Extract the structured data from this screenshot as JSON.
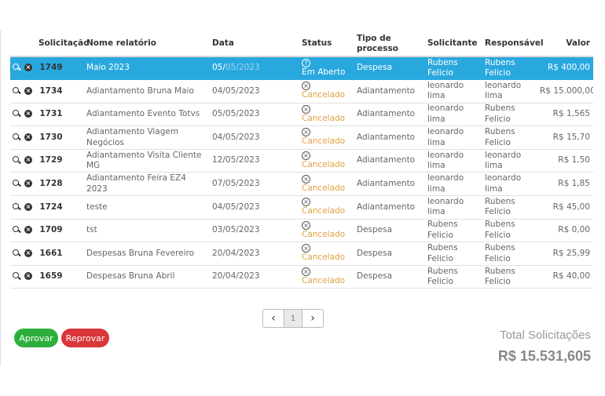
{
  "table": {
    "headers": {
      "solicitacao": "Solicitação",
      "nome": "Nome relatório",
      "data": "Data",
      "status": "Status",
      "tipo": "Tipo de processo",
      "solicitante": "Solicitante",
      "responsavel": "Responsável",
      "valor": "Valor"
    },
    "rows": [
      {
        "id": "1749",
        "nome": "Maio 2023",
        "data": "05/05/2023",
        "status": "Em Aberto",
        "tipo": "Despesa",
        "solicitante": "Rubens Felicio",
        "responsavel": "Rubens Felicio",
        "valor": "R$ 400,00",
        "selected": true
      },
      {
        "id": "1734",
        "nome": "Adiantamento Bruna Maio",
        "data": "04/05/2023",
        "status": "Cancelado",
        "tipo": "Adiantamento",
        "solicitante": "leonardo lima",
        "responsavel": "leonardo lima",
        "valor": "R$ 15.000,00"
      },
      {
        "id": "1731",
        "nome": "Adiantamento Evento Totvs",
        "data": "05/05/2023",
        "status": "Cancelado",
        "tipo": "Adiantamento",
        "solicitante": "leonardo lima",
        "responsavel": "Rubens Felicio",
        "valor": "R$ 1,565"
      },
      {
        "id": "1730",
        "nome": "Adiantamento Viagem Negócios",
        "data": "04/05/2023",
        "status": "Cancelado",
        "tipo": "Adiantamento",
        "solicitante": "leonardo lima",
        "responsavel": "Rubens Felicio",
        "valor": "R$ 15,70"
      },
      {
        "id": "1729",
        "nome": "Adiantamento Visita Cliente MG",
        "data": "12/05/2023",
        "status": "Cancelado",
        "tipo": "Adiantamento",
        "solicitante": "leonardo lima",
        "responsavel": "leonardo lima",
        "valor": "R$ 1,50"
      },
      {
        "id": "1728",
        "nome": "Adiantamento Feira EZ4 2023",
        "data": "07/05/2023",
        "status": "Cancelado",
        "tipo": "Adiantamento",
        "solicitante": "leonardo lima",
        "responsavel": "leonardo lima",
        "valor": "R$ 1,85"
      },
      {
        "id": "1724",
        "nome": "teste",
        "data": "04/05/2023",
        "status": "Cancelado",
        "tipo": "Adiantamento",
        "solicitante": "leonardo lima",
        "responsavel": "Rubens Felicio",
        "valor": "R$ 45,00"
      },
      {
        "id": "1709",
        "nome": "tst",
        "data": "03/05/2023",
        "status": "Cancelado",
        "tipo": "Despesa",
        "solicitante": "Rubens Felicio",
        "responsavel": "Rubens Felicio",
        "valor": "R$ 0,00"
      },
      {
        "id": "1661",
        "nome": "Despesas Bruna Fevereiro",
        "data": "20/04/2023",
        "status": "Cancelado",
        "tipo": "Despesa",
        "solicitante": "Rubens Felicio",
        "responsavel": "Rubens Felicio",
        "valor": "R$ 25,99"
      },
      {
        "id": "1659",
        "nome": "Despesas Bruna Abril",
        "data": "20/04/2023",
        "status": "Cancelado",
        "tipo": "Despesa",
        "solicitante": "Rubens Felicio",
        "responsavel": "Rubens Felicio",
        "valor": "R$ 40,00"
      }
    ]
  },
  "selected_date": {
    "day_month": "05/",
    "middle": "05",
    "year": "/2023"
  },
  "pagination": {
    "prev": "‹",
    "page": "1",
    "next": "›"
  },
  "actions": {
    "approve": "Aprovar",
    "reject": "Reprovar"
  },
  "total": {
    "label": "Total Solicitações",
    "value": "R$ 15.531,605"
  },
  "icons": {
    "row_view": "magnifier-icon",
    "row_cancel": "close-circle-icon",
    "status_open": "question-circle-icon",
    "status_cancelled": "x-circle-icon"
  },
  "colors": {
    "selected_row": "#29a8de",
    "cancelled": "#e0a040",
    "approve": "#2eaf3c",
    "reject": "#d9363a"
  }
}
